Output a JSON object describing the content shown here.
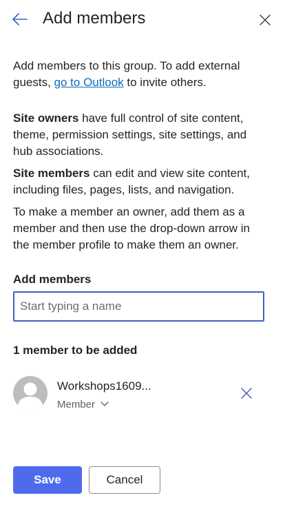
{
  "header": {
    "title": "Add members",
    "back_icon": "arrow-left-icon",
    "close_icon": "close-icon"
  },
  "intro": {
    "text_before": "Add members to this group. To add external guests, ",
    "link_text": "go to Outlook",
    "text_after": " to invite others."
  },
  "info": {
    "owners_bold": "Site owners",
    "owners_text": " have full control of site content, theme, permission settings, site settings, and hub associations.",
    "members_bold": "Site members",
    "members_text": " can edit and view site content, including files, pages, lists, and navigation.",
    "owner_tip": "To make a member an owner, add them as a member and then use the drop-down arrow in the member profile to make them an owner."
  },
  "add_members": {
    "label": "Add members",
    "placeholder": "Start typing a name",
    "value": ""
  },
  "pending": {
    "count_label": "1 member to be added",
    "members": [
      {
        "name": "Workshops1609...",
        "role": "Member"
      }
    ]
  },
  "actions": {
    "save_label": "Save",
    "cancel_label": "Cancel"
  },
  "colors": {
    "accent": "#4f6bed",
    "link": "#0f6cbd",
    "icon_blue": "#3f5fc7",
    "text": "#242424"
  }
}
